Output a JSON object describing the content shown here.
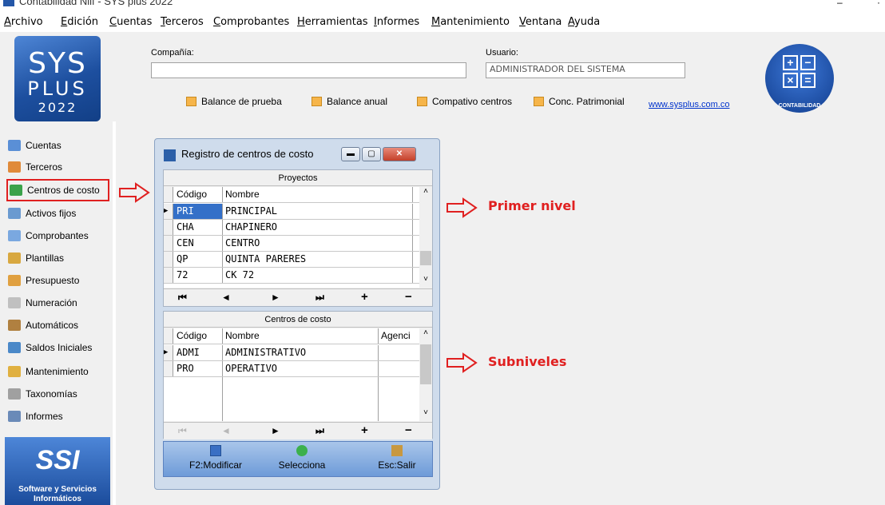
{
  "window": {
    "title": "Contabilidad Niif - SYS plus 2022",
    "minimize": "–",
    "close": "·"
  },
  "menu": [
    "Archivo",
    "Edición",
    "Cuentas",
    "Terceros",
    "Comprobantes",
    "Herramientas",
    "Informes",
    "Mantenimiento",
    "Ventana",
    "Ayuda"
  ],
  "logo": {
    "line1": "SYS",
    "line2": "PLUS",
    "line3": "2022"
  },
  "header": {
    "company_label": "Compañía:",
    "company_value": "",
    "user_label": "Usuario:",
    "user_value": "ADMINISTRADOR DEL SISTEMA",
    "quick_buttons": [
      "Balance de prueba",
      "Balance anual",
      "Compativo centros",
      "Conc. Patrimonial"
    ],
    "link": "www.sysplus.com.co",
    "module_badge": "CONTABILIDAD"
  },
  "sidebar": {
    "items": [
      {
        "label": "Cuentas",
        "icon": "ledger-icon",
        "color": "#5a8fd6"
      },
      {
        "label": "Terceros",
        "icon": "people-icon",
        "color": "#e08a3a"
      },
      {
        "label": "Centros de costo",
        "icon": "org-chart-icon",
        "color": "#3aa24a"
      },
      {
        "label": "Activos fijos",
        "icon": "chart-icon",
        "color": "#6a9ad0"
      },
      {
        "label": "Comprobantes",
        "icon": "voucher-icon",
        "color": "#7aa8e0"
      },
      {
        "label": "Plantillas",
        "icon": "template-icon",
        "color": "#d8a840"
      },
      {
        "label": "Presupuesto",
        "icon": "budget-icon",
        "color": "#e0a040"
      },
      {
        "label": "Numeración",
        "icon": "numbering-icon",
        "color": "#909090"
      },
      {
        "label": "Automáticos",
        "icon": "wand-icon",
        "color": "#b08040"
      },
      {
        "label": "Saldos Iniciales",
        "icon": "balance-icon",
        "color": "#4a88c8"
      },
      {
        "label": "Mantenimiento",
        "icon": "maintenance-icon",
        "color": "#e0b040"
      },
      {
        "label": "Taxonomías",
        "icon": "taxonomy-icon",
        "color": "#a0a0a0"
      },
      {
        "label": "Informes",
        "icon": "printer-icon",
        "color": "#6a8ab8"
      }
    ],
    "ssi_logo": "SSI",
    "ssi_text1": "Software y Servicios",
    "ssi_text2": "Informáticos"
  },
  "annotations": {
    "first": "Primer nivel",
    "second": "Subniveles",
    "accent": "#e02020"
  },
  "dialog": {
    "title": "Registro de centros de costo",
    "projects": {
      "caption": "Proyectos",
      "headers": [
        "Código",
        "Nombre"
      ],
      "rows": [
        {
          "code": "PRI",
          "name": "PRINCIPAL"
        },
        {
          "code": "CHA",
          "name": "CHAPINERO"
        },
        {
          "code": "CEN",
          "name": "CENTRO"
        },
        {
          "code": "QP",
          "name": "QUINTA PARERES"
        },
        {
          "code": "72",
          "name": "CK 72"
        }
      ]
    },
    "centers": {
      "caption": "Centros de costo",
      "headers": [
        "Código",
        "Nombre",
        "Agenci"
      ],
      "rows": [
        {
          "code": "ADMI",
          "name": "ADMINISTRATIVO",
          "agency": ""
        },
        {
          "code": "PRO",
          "name": "OPERATIVO",
          "agency": ""
        }
      ]
    },
    "nav": {
      "first": "⏮",
      "prev": "◄",
      "next": "►",
      "last": "⏭",
      "add": "+",
      "remove": "−"
    },
    "footer": {
      "modify": "F2:Modificar",
      "select": "Selecciona",
      "exit": "Esc:Salir"
    }
  }
}
